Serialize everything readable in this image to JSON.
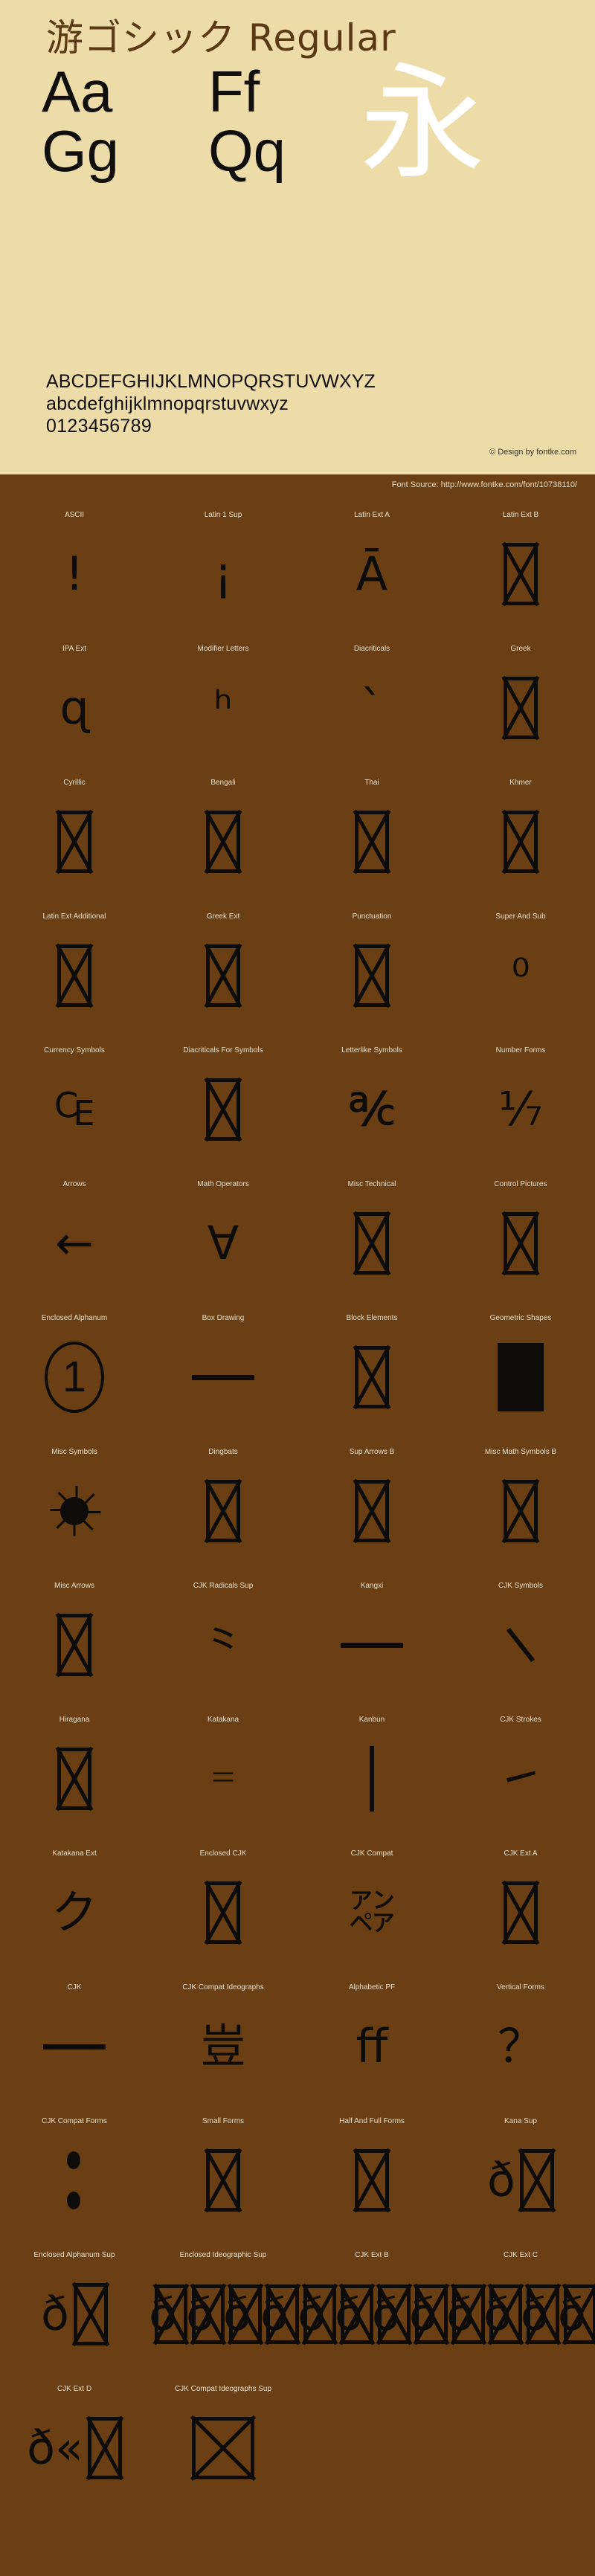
{
  "header": {
    "font_title": "游ゴシック Regular",
    "showcase_rows": [
      {
        "left": "Aa",
        "right": "Ff"
      },
      {
        "left": "Gg",
        "right": "Qq"
      }
    ],
    "kanji_sample": "永",
    "alphabet_uppercase": "ABCDEFGHIJKLMNOPQRSTUVWXYZ",
    "alphabet_lowercase": "abcdefghijklmnopqrstuvwxyz",
    "digits": "0123456789",
    "credit": "© Design by fontke.com"
  },
  "source_bar": {
    "text": "Font Source: http://www.fontke.com/font/10738110/"
  },
  "colors": {
    "cream_background": "#EEDCA8",
    "brown_background": "#6B3F14",
    "title_brown": "#5A3A12",
    "glyph_black": "#0D0C0A",
    "kanji_white": "#FFFFFF",
    "block_label_cream": "#EADFC9"
  },
  "unicode_blocks": [
    {
      "label": "ASCII",
      "glyph": "!",
      "kind": "text"
    },
    {
      "label": "Latin 1 Sup",
      "glyph": "¡",
      "kind": "text"
    },
    {
      "label": "Latin Ext A",
      "glyph": "Ā",
      "kind": "text"
    },
    {
      "label": "Latin Ext B",
      "glyph": "",
      "kind": "tofu"
    },
    {
      "label": "IPA Ext",
      "glyph": "ɋ",
      "kind": "text"
    },
    {
      "label": "Modifier Letters",
      "glyph": "ʰ",
      "kind": "text"
    },
    {
      "label": "Diacriticals",
      "glyph": "`",
      "kind": "text"
    },
    {
      "label": "Greek",
      "glyph": "",
      "kind": "tofu"
    },
    {
      "label": "Cyrillic",
      "glyph": "",
      "kind": "tofu"
    },
    {
      "label": "Bengali",
      "glyph": "",
      "kind": "tofu"
    },
    {
      "label": "Thai",
      "glyph": "",
      "kind": "tofu"
    },
    {
      "label": "Khmer",
      "glyph": "",
      "kind": "tofu"
    },
    {
      "label": "Latin Ext Additional",
      "glyph": "",
      "kind": "tofu"
    },
    {
      "label": "Greek Ext",
      "glyph": "",
      "kind": "tofu"
    },
    {
      "label": "Punctuation",
      "glyph": "",
      "kind": "tofu"
    },
    {
      "label": "Super And Sub",
      "glyph": "⁰",
      "kind": "text"
    },
    {
      "label": "Currency Symbols",
      "glyph": "₠",
      "kind": "text"
    },
    {
      "label": "Diacriticals For Symbols",
      "glyph": "",
      "kind": "tofu"
    },
    {
      "label": "Letterlike Symbols",
      "glyph": "℀",
      "kind": "text"
    },
    {
      "label": "Number Forms",
      "glyph": "⅐",
      "kind": "text"
    },
    {
      "label": "Arrows",
      "glyph": "←",
      "kind": "text"
    },
    {
      "label": "Math Operators",
      "glyph": "∀",
      "kind": "text"
    },
    {
      "label": "Misc Technical",
      "glyph": "",
      "kind": "tofu"
    },
    {
      "label": "Control Pictures",
      "glyph": "",
      "kind": "tofu"
    },
    {
      "label": "Enclosed Alphanum",
      "glyph": "1",
      "kind": "circled"
    },
    {
      "label": "Box Drawing",
      "glyph": "─",
      "kind": "hrule"
    },
    {
      "label": "Block Elements",
      "glyph": "",
      "kind": "tofu"
    },
    {
      "label": "Geometric Shapes",
      "glyph": "■",
      "kind": "solid"
    },
    {
      "label": "Misc Symbols",
      "glyph": "☀",
      "kind": "sun"
    },
    {
      "label": "Dingbats",
      "glyph": "",
      "kind": "tofu"
    },
    {
      "label": "Sup Arrows B",
      "glyph": "",
      "kind": "tofu"
    },
    {
      "label": "Misc Math Symbols B",
      "glyph": "",
      "kind": "tofu"
    },
    {
      "label": "Misc Arrows",
      "glyph": "",
      "kind": "tofu"
    },
    {
      "label": "CJK Radicals Sup",
      "glyph": "⺀",
      "kind": "text"
    },
    {
      "label": "Kangxi",
      "glyph": "⼀",
      "kind": "hrule"
    },
    {
      "label": "CJK Symbols",
      "glyph": "、",
      "kind": "dstroke"
    },
    {
      "label": "Hiragana",
      "glyph": "",
      "kind": "tofu"
    },
    {
      "label": "Katakana",
      "glyph": "゠",
      "kind": "text"
    },
    {
      "label": "Kanbun",
      "glyph": "㆐",
      "kind": "vstroke"
    },
    {
      "label": "CJK Strokes",
      "glyph": "㇀",
      "kind": "text"
    },
    {
      "label": "Katakana Ext",
      "glyph": "ク",
      "kind": "text"
    },
    {
      "label": "Enclosed CJK",
      "glyph": "",
      "kind": "tofu"
    },
    {
      "label": "CJK Compat",
      "glyph": "㌂",
      "kind": "text"
    },
    {
      "label": "CJK Ext A",
      "glyph": "",
      "kind": "tofu"
    },
    {
      "label": "CJK",
      "glyph": "一",
      "kind": "hrule"
    },
    {
      "label": "CJK Compat Ideographs",
      "glyph": "豈",
      "kind": "text"
    },
    {
      "label": "Alphabetic PF",
      "glyph": "ﬀ",
      "kind": "text"
    },
    {
      "label": "Vertical Forms",
      "glyph": "？",
      "kind": "text"
    },
    {
      "label": "CJK Compat Forms",
      "glyph": "︰",
      "kind": "dots"
    },
    {
      "label": "Small Forms",
      "glyph": "",
      "kind": "tofu"
    },
    {
      "label": "Half And Full Forms",
      "glyph": "",
      "kind": "tofu"
    },
    {
      "label": "Kana Sup",
      "glyph": "ð",
      "kind": "glyph-tofu"
    },
    {
      "label": "Enclosed Alphanum Sup",
      "glyph": "ð",
      "kind": "glyph-tofu"
    },
    {
      "label": "Enclosed Ideographic Sup",
      "glyph": "ð",
      "kind": "overflow"
    },
    {
      "label": "CJK Ext B",
      "glyph": "ð",
      "kind": "overflow"
    },
    {
      "label": "CJK Ext C",
      "glyph": "ð",
      "kind": "overflow"
    },
    {
      "label": "CJK Ext D",
      "glyph": "ð«",
      "kind": "glyph-tofu"
    },
    {
      "label": "CJK Compat Ideographs Sup",
      "glyph": "",
      "kind": "tofu-wide"
    }
  ]
}
